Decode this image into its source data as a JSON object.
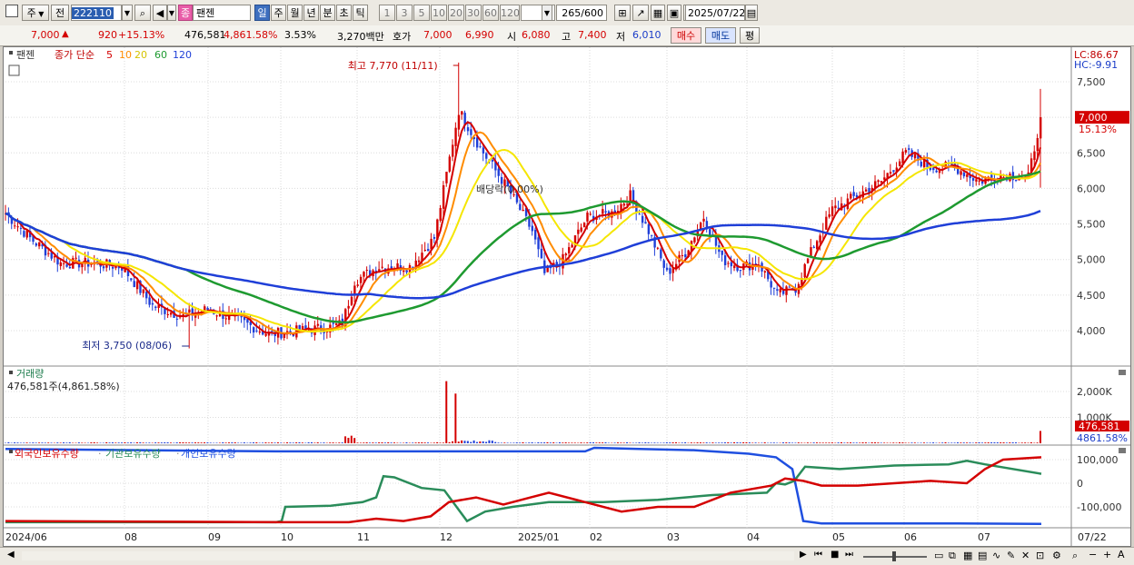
{
  "toolbar": {
    "period_select": "주",
    "prev_label": "전",
    "stock_code": "222110",
    "market_badge": "종",
    "stock_name": "팬젠",
    "periods": [
      "일",
      "주",
      "월",
      "년",
      "분",
      "초",
      "틱"
    ],
    "selected_period": "일",
    "intervals": [
      "1",
      "3",
      "5",
      "10",
      "20",
      "30",
      "60",
      "120"
    ],
    "bar_count": "265",
    "bar_total": "600",
    "date": "2025/07/22"
  },
  "quote": {
    "price": "7,000",
    "change_arrow": "▲",
    "change": "920",
    "change_pct": "+15.13%",
    "volume": "476,581",
    "volume_pct": "4,861.58%",
    "turnover_pct": "3.53%",
    "amount": "3,270백만",
    "hoga_label": "호가",
    "ask": "7,000",
    "bid": "6,990",
    "open_label": "시",
    "open": "6,080",
    "high_label": "고",
    "high": "7,400",
    "low_label": "저",
    "low": "6,010",
    "buy_label": "매수",
    "sell_label": "매도",
    "eval_label": "평"
  },
  "price_panel": {
    "stock_name": "팬젠",
    "indicator": "종가 단순",
    "ma_periods": [
      "5",
      "10",
      "20",
      "60",
      "120"
    ],
    "lc": "LC:86.67",
    "hc": "HC:-9.91",
    "price_tag": "7,000",
    "pct_tag": "15.13%",
    "high_annotation": "최고 7,770 (11/11)",
    "low_annotation": "최저 3,750 (08/06)",
    "dividend_annotation": "배당락(0.00%)",
    "y_ticks": [
      "7,500",
      "7,000",
      "6,500",
      "6,000",
      "5,500",
      "5,000",
      "4,500",
      "4,000"
    ]
  },
  "volume_panel": {
    "title": "거래량",
    "value_label": "476,581주(4,861.58%)",
    "y_ticks": [
      "2,000K",
      "1,000K"
    ],
    "tag_value": "476,581",
    "tag_pct": "4861.58%"
  },
  "holdings_panel": {
    "series_labels": [
      "외국인보유수량",
      "기관보유수량",
      "개인보유수량"
    ],
    "y_ticks": [
      "100,000",
      "0",
      "-100,000"
    ]
  },
  "x_axis": [
    "2024/06",
    "08",
    "09",
    "10",
    "11",
    "12",
    "2025/01",
    "02",
    "03",
    "04",
    "05",
    "06",
    "07",
    "07/22"
  ],
  "colors": {
    "ma5": "#d40000",
    "ma10": "#ff8c00",
    "ma20": "#f5e600",
    "ma60": "#1e9a30",
    "ma120": "#1f3fd8",
    "up": "#d40000",
    "down": "#1f3fd8",
    "foreign": "#d40000",
    "institution": "#2a8c5a",
    "individual": "#1f4fe0"
  }
}
